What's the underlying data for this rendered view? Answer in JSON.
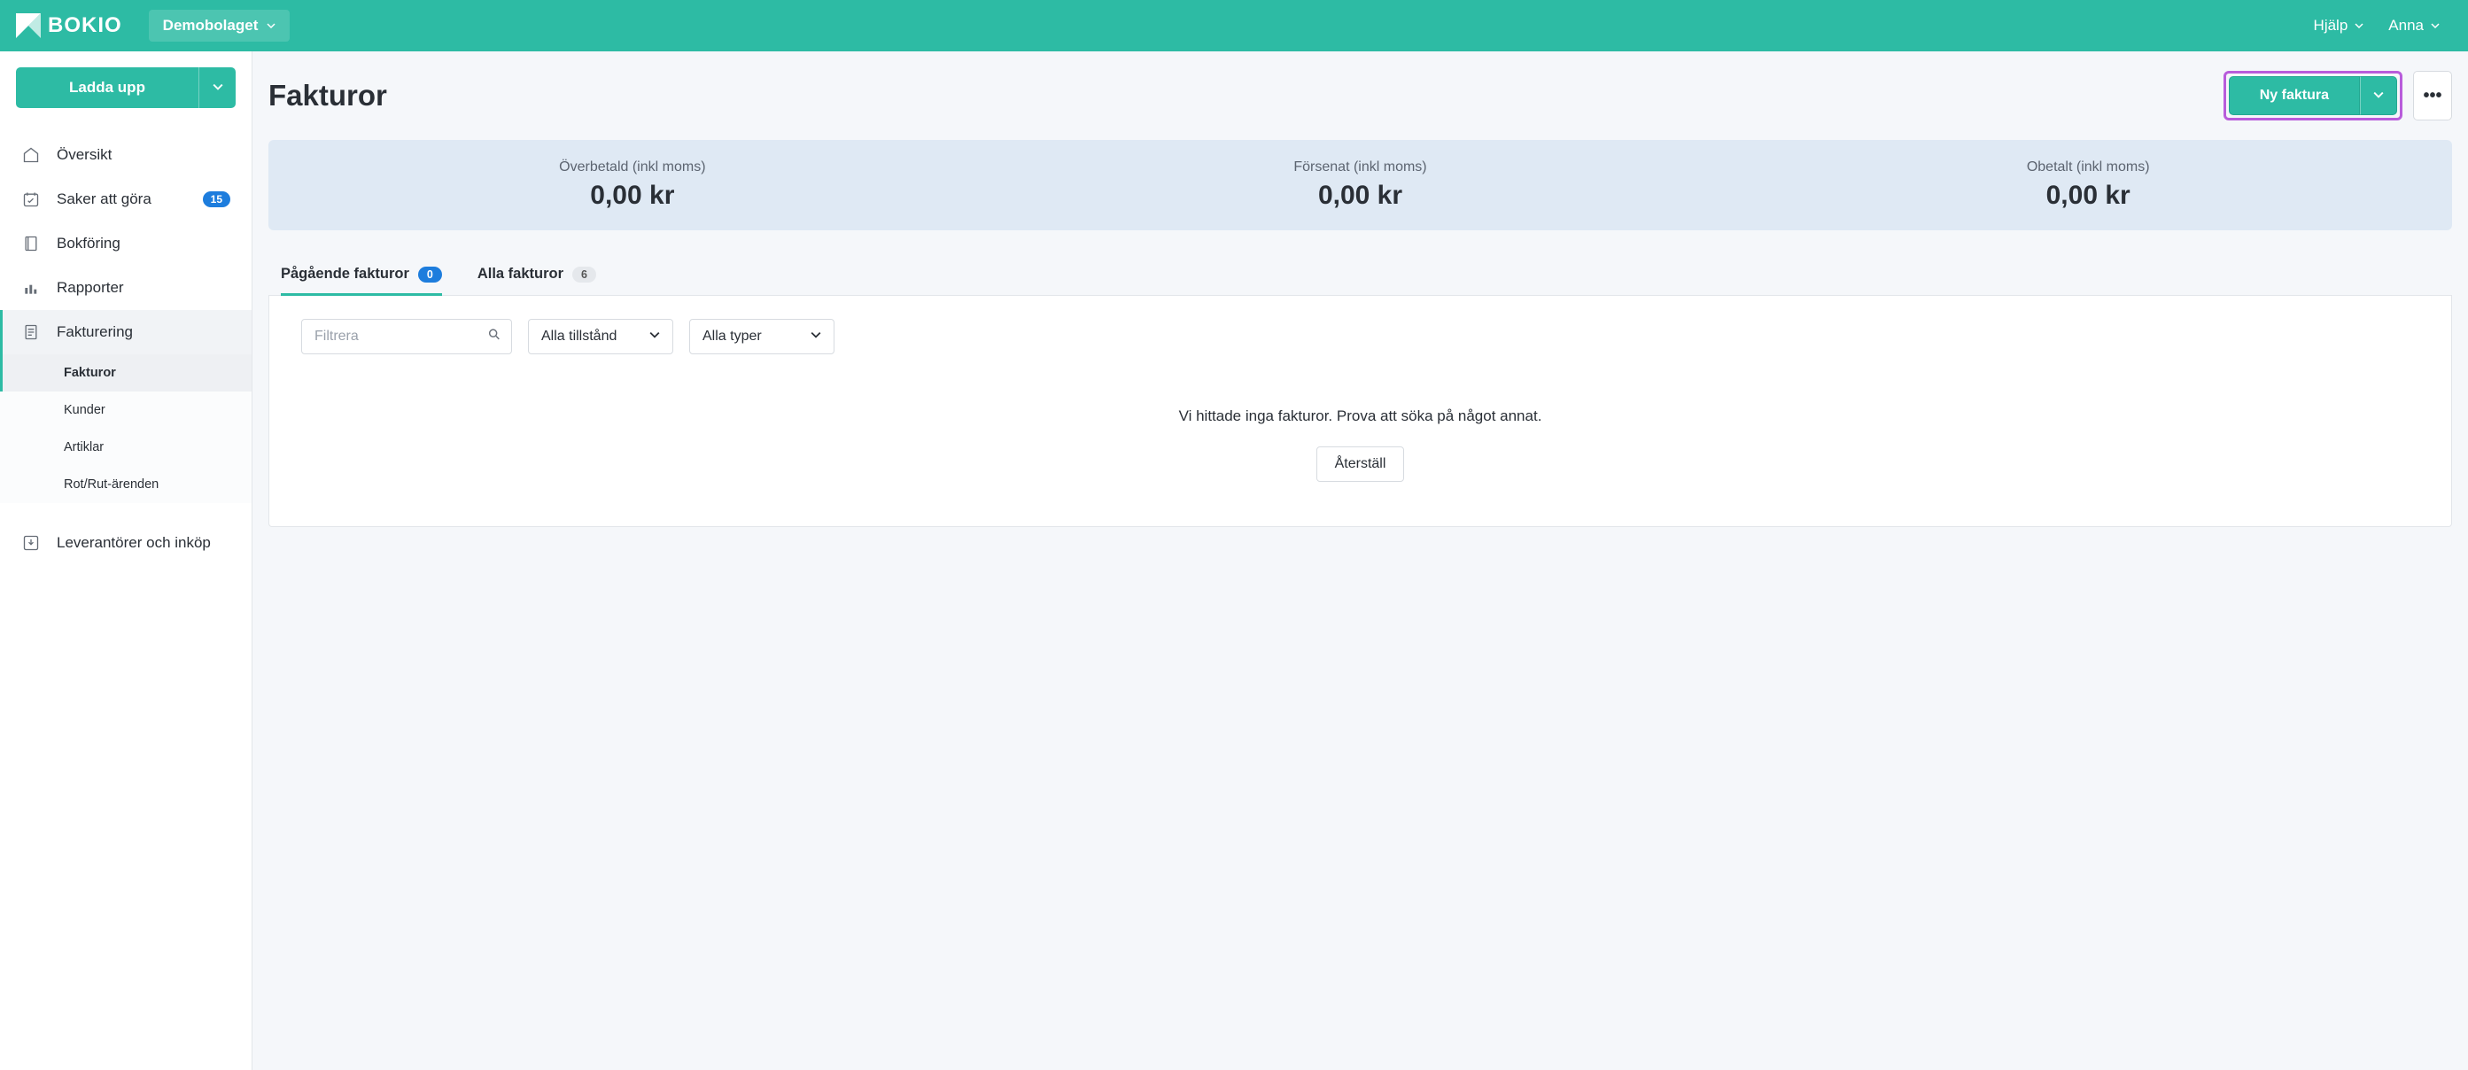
{
  "brand": "BOKIO",
  "company": "Demobolaget",
  "topLinks": {
    "help": "Hjälp",
    "user": "Anna"
  },
  "upload": {
    "label": "Ladda upp"
  },
  "nav": {
    "overview": "Översikt",
    "todo": {
      "label": "Saker att göra",
      "badge": "15"
    },
    "bookkeeping": "Bokföring",
    "reports": "Rapporter",
    "invoicing": "Fakturering",
    "suppliers": "Leverantörer och inköp"
  },
  "subnav": {
    "invoices": "Fakturor",
    "customers": "Kunder",
    "articles": "Artiklar",
    "rotrut": "Rot/Rut-ärenden"
  },
  "page": {
    "title": "Fakturor"
  },
  "actions": {
    "newInvoice": "Ny faktura"
  },
  "summary": {
    "overpaid": {
      "label": "Överbetald (inkl moms)",
      "value": "0,00 kr"
    },
    "overdue": {
      "label": "Försenat (inkl moms)",
      "value": "0,00 kr"
    },
    "unpaid": {
      "label": "Obetalt (inkl moms)",
      "value": "0,00 kr"
    }
  },
  "tabs": {
    "ongoing": {
      "label": "Pågående fakturor",
      "count": "0"
    },
    "all": {
      "label": "Alla fakturor",
      "count": "6"
    }
  },
  "filters": {
    "placeholder": "Filtrera",
    "status": "Alla tillstånd",
    "type": "Alla typer"
  },
  "empty": {
    "message": "Vi hittade inga fakturor. Prova att söka på något annat.",
    "reset": "Återställ"
  }
}
